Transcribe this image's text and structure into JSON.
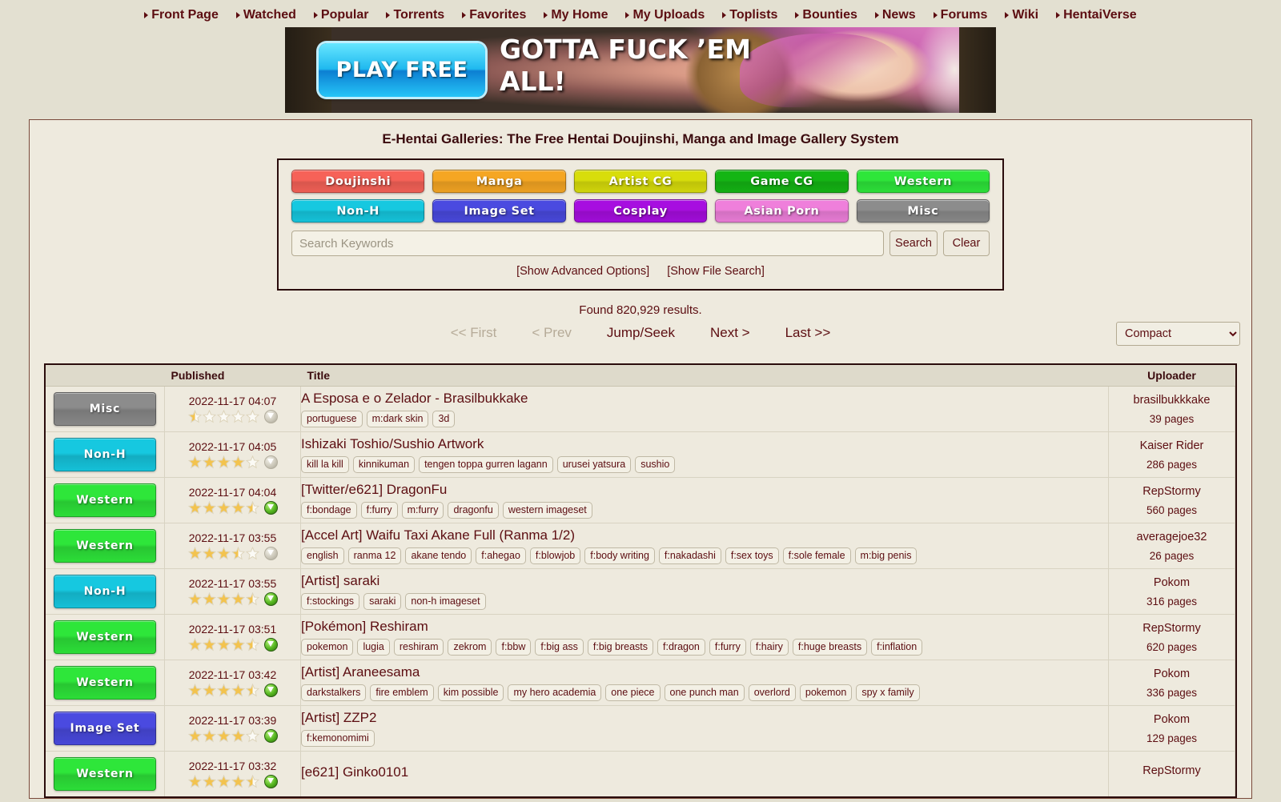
{
  "nav": {
    "items": [
      {
        "label": "Front Page"
      },
      {
        "label": "Watched"
      },
      {
        "label": "Popular"
      },
      {
        "label": "Torrents"
      },
      {
        "label": "Favorites"
      },
      {
        "label": "My Home"
      },
      {
        "label": "My Uploads"
      },
      {
        "label": "Toplists"
      },
      {
        "label": "Bounties"
      },
      {
        "label": "News"
      },
      {
        "label": "Forums"
      },
      {
        "label": "Wiki"
      },
      {
        "label": "HentaiVerse"
      }
    ]
  },
  "banner": {
    "button_label": "PLAY FREE",
    "headline": "GOTTA FUCK ’EM ALL!"
  },
  "site": {
    "title": "E-Hentai Galleries: The Free Hentai Doujinshi, Manga and Image Gallery System"
  },
  "categories": [
    {
      "label": "Doujinshi",
      "color": "#f66258"
    },
    {
      "label": "Manga",
      "color": "#f5a623"
    },
    {
      "label": "Artist CG",
      "color": "#d8dd0b"
    },
    {
      "label": "Game CG",
      "color": "#14b514"
    },
    {
      "label": "Western",
      "color": "#2ee63a"
    },
    {
      "label": "Non-H",
      "color": "#16c8e0"
    },
    {
      "label": "Image Set",
      "color": "#4a4ae0"
    },
    {
      "label": "Cosplay",
      "color": "#a70ee0"
    },
    {
      "label": "Asian Porn",
      "color": "#ef7fdb"
    },
    {
      "label": "Misc",
      "color": "#8c8c8c"
    }
  ],
  "search": {
    "value": "",
    "placeholder": "Search Keywords",
    "search_label": "Search",
    "clear_label": "Clear",
    "advanced_label": "[Show Advanced Options]",
    "file_search_label": "[Show File Search]"
  },
  "results": {
    "found_text": "Found 820,929 results.",
    "pager": [
      {
        "label": "<< First",
        "disabled": true
      },
      {
        "label": "< Prev",
        "disabled": true
      },
      {
        "label": "Jump/Seek",
        "disabled": false
      },
      {
        "label": "Next >",
        "disabled": false
      },
      {
        "label": "Last >>",
        "disabled": false
      }
    ],
    "view_mode": "Compact",
    "view_options": [
      "Compact"
    ],
    "columns": {
      "category": "",
      "published": "Published",
      "title": "Title",
      "uploader": "Uploader"
    },
    "rows": [
      {
        "category": "Misc",
        "category_color": "#8c8c8c",
        "published": "2022-11-17 04:07",
        "rating": 0.5,
        "download": false,
        "title": "A Esposa e o Zelador - Brasilbukkake",
        "tags": [
          "portuguese",
          "m:dark skin",
          "3d"
        ],
        "uploader": "brasilbukkkake",
        "pages": "39 pages"
      },
      {
        "category": "Non-H",
        "category_color": "#16c8e0",
        "published": "2022-11-17 04:05",
        "rating": 4.0,
        "download": false,
        "title": "Ishizaki Toshio/Sushio Artwork",
        "tags": [
          "kill la kill",
          "kinnikuman",
          "tengen toppa gurren lagann",
          "urusei yatsura",
          "sushio"
        ],
        "uploader": "Kaiser Rider",
        "pages": "286 pages"
      },
      {
        "category": "Western",
        "category_color": "#2ee63a",
        "published": "2022-11-17 04:04",
        "rating": 4.5,
        "download": true,
        "title": "[Twitter/e621] DragonFu",
        "tags": [
          "f:bondage",
          "f:furry",
          "m:furry",
          "dragonfu",
          "western imageset"
        ],
        "uploader": "RepStormy",
        "pages": "560 pages"
      },
      {
        "category": "Western",
        "category_color": "#2ee63a",
        "published": "2022-11-17 03:55",
        "rating": 3.5,
        "download": false,
        "title": "[Accel Art] Waifu Taxi Akane Full (Ranma 1/2)",
        "tags": [
          "english",
          "ranma 12",
          "akane tendo",
          "f:ahegao",
          "f:blowjob",
          "f:body writing",
          "f:nakadashi",
          "f:sex toys",
          "f:sole female",
          "m:big penis"
        ],
        "uploader": "averagejoe32",
        "pages": "26 pages"
      },
      {
        "category": "Non-H",
        "category_color": "#16c8e0",
        "published": "2022-11-17 03:55",
        "rating": 4.5,
        "download": true,
        "title": "[Artist] saraki",
        "tags": [
          "f:stockings",
          "saraki",
          "non-h imageset"
        ],
        "uploader": "Pokom",
        "pages": "316 pages"
      },
      {
        "category": "Western",
        "category_color": "#2ee63a",
        "published": "2022-11-17 03:51",
        "rating": 4.5,
        "download": true,
        "title": "[Pokémon] Reshiram",
        "tags": [
          "pokemon",
          "lugia",
          "reshiram",
          "zekrom",
          "f:bbw",
          "f:big ass",
          "f:big breasts",
          "f:dragon",
          "f:furry",
          "f:hairy",
          "f:huge breasts",
          "f:inflation"
        ],
        "uploader": "RepStormy",
        "pages": "620 pages"
      },
      {
        "category": "Western",
        "category_color": "#2ee63a",
        "published": "2022-11-17 03:42",
        "rating": 4.5,
        "download": true,
        "title": "[Artist] Araneesama",
        "tags": [
          "darkstalkers",
          "fire emblem",
          "kim possible",
          "my hero academia",
          "one piece",
          "one punch man",
          "overlord",
          "pokemon",
          "spy x family"
        ],
        "uploader": "Pokom",
        "pages": "336 pages"
      },
      {
        "category": "Image Set",
        "category_color": "#4a4ae0",
        "published": "2022-11-17 03:39",
        "rating": 4.0,
        "download": true,
        "title": "[Artist] ZZP2",
        "tags": [
          "f:kemonomimi"
        ],
        "uploader": "Pokom",
        "pages": "129 pages"
      },
      {
        "category": "Western",
        "category_color": "#2ee63a",
        "published": "2022-11-17 03:32",
        "rating": 4.5,
        "download": true,
        "title": "[e621] Ginko0101",
        "tags": [],
        "uploader": "RepStormy",
        "pages": ""
      }
    ]
  },
  "colors": {
    "page_bg": "#e3e0d1",
    "panel_bg": "#eeeade",
    "text": "#5c0d11",
    "border_dark": "#2a0c0c",
    "star_filled": "#f2c14a",
    "star_empty": "#f7f5ee",
    "download_on": "#54b51f"
  }
}
